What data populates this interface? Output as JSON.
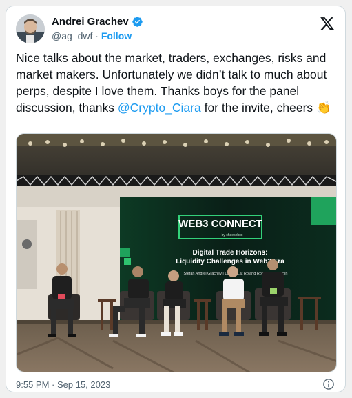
{
  "author": {
    "name": "Andrei Grachev",
    "handle": "@ag_dwf",
    "separator": "·",
    "follow_label": "Follow"
  },
  "tweet": {
    "text_before": "Nice talks about the market, traders, exchanges, risks and market makers. Unfortunately we didn’t talk to much about perps, despite I love them. Thanks boys for the panel discussion, thanks ",
    "mention": "@Crypto_Ciara",
    "text_after": " for the invite, cheers ",
    "emoji": "👏"
  },
  "photo": {
    "screen_logo": "WEB3 CONNECT",
    "screen_logo_sub": "by cheesebox",
    "screen_title_1": "Digital Trade Horizons:",
    "screen_title_2": "Liquidity Challenges in Web3 Era",
    "screen_speakers": "Stefan   Andrei Grachev | Lorenz Lat   Roland Rosenblum   Turpin"
  },
  "timestamp": "9:55 PM · Sep 15, 2023",
  "colors": {
    "accent": "#1d9bf0",
    "text": "#0f1419",
    "muted": "#536471"
  },
  "icons": [
    "verified-badge-icon",
    "x-logo-icon",
    "info-icon"
  ]
}
